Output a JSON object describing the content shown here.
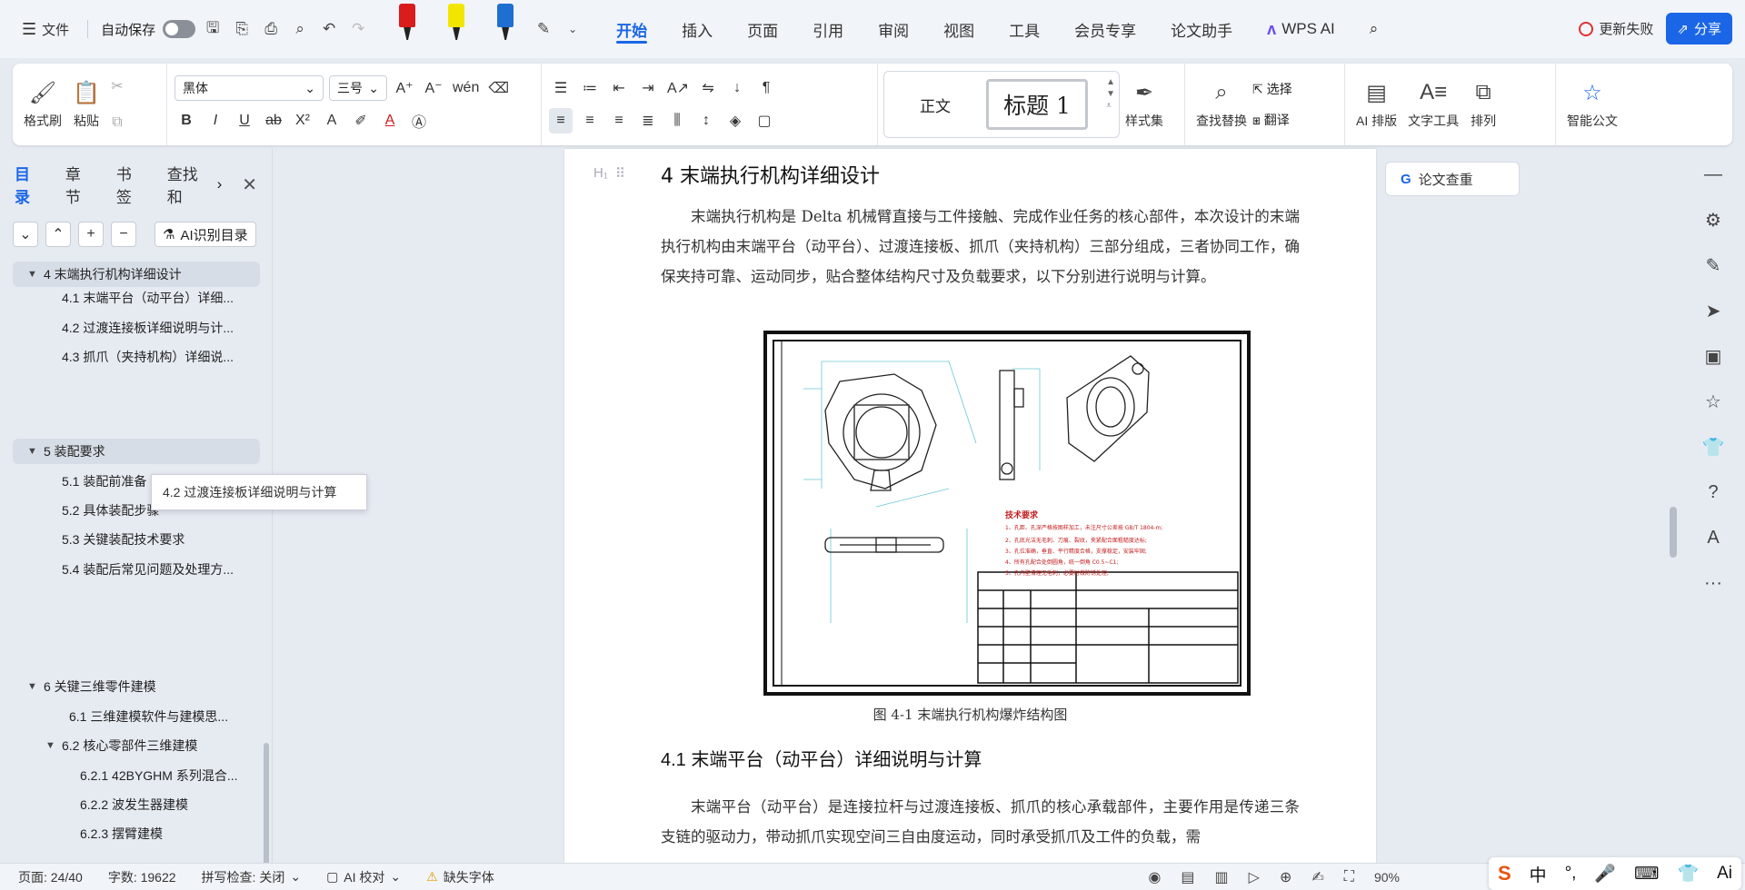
{
  "titlebar": {
    "file_label": "文件",
    "autosave_label": "自动保存",
    "tabs": [
      "开始",
      "插入",
      "页面",
      "引用",
      "审阅",
      "视图",
      "工具",
      "会员专享",
      "论文助手"
    ],
    "wps_ai_label": "WPS AI",
    "sync_label": "更新失败",
    "share_label": "分享",
    "pen_colors": [
      "#d91c1c",
      "#f2e600",
      "#1e6fd1"
    ]
  },
  "ribbon": {
    "format_painter": "格式刷",
    "paste": "粘贴",
    "font_name": "黑体",
    "font_size": "三号",
    "style_normal": "正文",
    "style_h1": "标题 1",
    "style_set": "样式集",
    "find_replace": "查找替换",
    "select": "选择",
    "translate": "翻译",
    "ai_layout": "AI 排版",
    "text_tools": "文字工具",
    "arrange": "排列",
    "smart_doc": "智能公文"
  },
  "nav": {
    "tabs": [
      "目录",
      "章节",
      "书签",
      "查找和"
    ],
    "ai_toc": "AI识别目录",
    "items": [
      {
        "label": "4  末端执行机构详细设计",
        "level": 1
      },
      {
        "label": "4.1  末端平台（动平台）详细...",
        "level": 2
      },
      {
        "label": "4.2  过渡连接板详细说明与计...",
        "level": 2
      },
      {
        "label": "4.3  抓爪（夹持机构）详细说...",
        "level": 2
      },
      {
        "label": "5  装配要求",
        "level": 1
      },
      {
        "label": "5.1  装配前准备",
        "level": 2
      },
      {
        "label": "5.2  具体装配步骤",
        "level": 2
      },
      {
        "label": "5.3  关键装配技术要求",
        "level": 2
      },
      {
        "label": "5.4  装配后常见问题及处理方...",
        "level": 2
      },
      {
        "label": "6  关键三维零件建模",
        "level": 1
      },
      {
        "label": "6.1  三维建模软件与建模思...",
        "level": 2
      },
      {
        "label": "6.2  核心零部件三维建模",
        "level": 2
      },
      {
        "label": "6.2.1  42BYGHM 系列混合...",
        "level": 3
      },
      {
        "label": "6.2.2  波发生器建模",
        "level": 3
      },
      {
        "label": "6.2.3  摆臂建模",
        "level": 3
      }
    ],
    "tooltip": "4.2 过渡连接板详细说明与计算"
  },
  "doc": {
    "heading": "4  末端执行机构详细设计",
    "para1": "末端执行机构是 Delta 机械臂直接与工件接触、完成作业任务的核心部件，本次设计的末端执行机构由末端平台（动平台）、过渡连接板、抓爪（夹持机构）三部分组成，三者协同工作，确保夹持可靠、运动同步，贴合整体结构尺寸及负载要求，以下分别进行说明与计算。",
    "caption": "图 4-1 末端执行机构爆炸结构图",
    "drawing_title": "技术要求",
    "drawing_notes": [
      "1、孔距、孔深严格按图样加工，未注尺寸公差按 GB/T 1804-m;",
      "2、孔底光洁无毛刺、刀痕、裂纹，夹紧配合面粗糙度达标;",
      "3、孔位准确，垂直、平行精度合格，支撑稳定，安装牢固;",
      "4、所有孔配合处倒圆角，统一倒角 C0.5~C1;",
      "5、孔内壁清理无毛刺，必要时做防锈处理;"
    ],
    "heading2": "4.1  末端平台（动平台）详细说明与计算",
    "para2": "末端平台（动平台）是连接拉杆与过渡连接板、抓爪的核心承载部件，主要作用是传递三条支链的驱动力，带动抓爪实现空间三自由度运动，同时承受抓爪及工件的负载，需",
    "paper_check": "论文查重"
  },
  "status": {
    "page": "页面: 24/40",
    "words": "字数: 19622",
    "spell": "拼写检查: 关闭",
    "ai_check": "AI 校对",
    "missing_font": "缺失字体",
    "zoom": "90%"
  },
  "ime": {
    "lang": "中"
  }
}
